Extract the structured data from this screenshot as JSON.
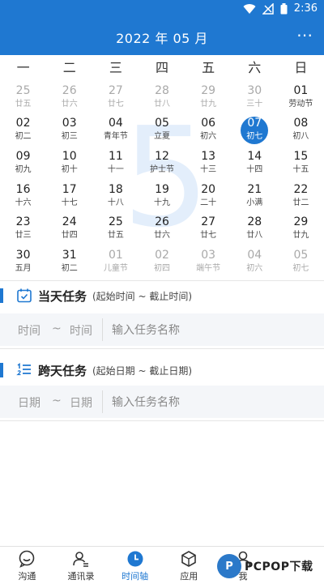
{
  "status": {
    "time": "2:36"
  },
  "header": {
    "title": "2022 年 05 月"
  },
  "calendar": {
    "weekdays": [
      "一",
      "二",
      "三",
      "四",
      "五",
      "六",
      "日"
    ],
    "watermark": "5",
    "days": [
      {
        "d": "25",
        "l": "廿五",
        "m": true
      },
      {
        "d": "26",
        "l": "廿六",
        "m": true
      },
      {
        "d": "27",
        "l": "廿七",
        "m": true
      },
      {
        "d": "28",
        "l": "廿八",
        "m": true
      },
      {
        "d": "29",
        "l": "廿九",
        "m": true
      },
      {
        "d": "30",
        "l": "三十",
        "m": true
      },
      {
        "d": "01",
        "l": "劳动节"
      },
      {
        "d": "02",
        "l": "初二"
      },
      {
        "d": "03",
        "l": "初三"
      },
      {
        "d": "04",
        "l": "青年节"
      },
      {
        "d": "05",
        "l": "立夏"
      },
      {
        "d": "06",
        "l": "初六"
      },
      {
        "d": "07",
        "l": "初七",
        "s": true
      },
      {
        "d": "08",
        "l": "初八"
      },
      {
        "d": "09",
        "l": "初九"
      },
      {
        "d": "10",
        "l": "初十"
      },
      {
        "d": "11",
        "l": "十一"
      },
      {
        "d": "12",
        "l": "护士节"
      },
      {
        "d": "13",
        "l": "十三"
      },
      {
        "d": "14",
        "l": "十四"
      },
      {
        "d": "15",
        "l": "十五"
      },
      {
        "d": "16",
        "l": "十六"
      },
      {
        "d": "17",
        "l": "十七"
      },
      {
        "d": "18",
        "l": "十八"
      },
      {
        "d": "19",
        "l": "十九"
      },
      {
        "d": "20",
        "l": "二十"
      },
      {
        "d": "21",
        "l": "小满"
      },
      {
        "d": "22",
        "l": "廿二"
      },
      {
        "d": "23",
        "l": "廿三"
      },
      {
        "d": "24",
        "l": "廿四"
      },
      {
        "d": "25",
        "l": "廿五"
      },
      {
        "d": "26",
        "l": "廿六"
      },
      {
        "d": "27",
        "l": "廿七"
      },
      {
        "d": "28",
        "l": "廿八"
      },
      {
        "d": "29",
        "l": "廿九"
      },
      {
        "d": "30",
        "l": "五月"
      },
      {
        "d": "31",
        "l": "初二"
      },
      {
        "d": "01",
        "l": "儿童节",
        "m": true
      },
      {
        "d": "02",
        "l": "初四",
        "m": true
      },
      {
        "d": "03",
        "l": "端午节",
        "m": true
      },
      {
        "d": "04",
        "l": "初六",
        "m": true
      },
      {
        "d": "05",
        "l": "初七",
        "m": true
      }
    ]
  },
  "same_day": {
    "title": "当天任务",
    "hint": "(起始时间 ~ 截止时间)",
    "start": "时间",
    "tilde": "~",
    "end": "时间",
    "placeholder": "输入任务名称"
  },
  "multi_day": {
    "title": "跨天任务",
    "hint": "(起始日期 ~ 截止日期)",
    "start": "日期",
    "tilde": "~",
    "end": "日期",
    "placeholder": "输入任务名称"
  },
  "tabs": [
    {
      "label": "沟通"
    },
    {
      "label": "通讯录"
    },
    {
      "label": "时间轴"
    },
    {
      "label": "应用"
    },
    {
      "label": "我"
    }
  ],
  "brand": {
    "text": "PCPOP下载",
    "mark": "P"
  },
  "colors": {
    "primary": "#1f78d1"
  }
}
